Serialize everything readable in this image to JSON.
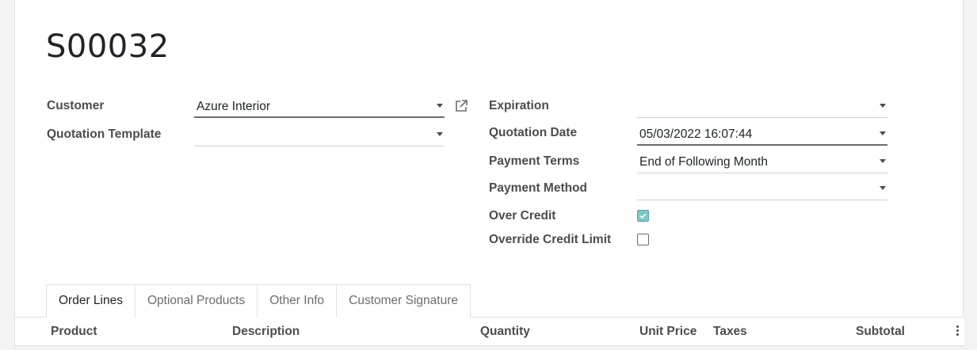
{
  "record": {
    "title": "S00032"
  },
  "left_fields": {
    "customer": {
      "label": "Customer",
      "value": "Azure Interior"
    },
    "quotation_template": {
      "label": "Quotation Template",
      "value": ""
    }
  },
  "right_fields": {
    "expiration": {
      "label": "Expiration",
      "value": ""
    },
    "quotation_date": {
      "label": "Quotation Date",
      "value": "05/03/2022 16:07:44"
    },
    "payment_terms": {
      "label": "Payment Terms",
      "value": "End of Following Month"
    },
    "payment_method": {
      "label": "Payment Method",
      "value": ""
    },
    "over_credit": {
      "label": "Over Credit",
      "checked": true
    },
    "override_credit_limit": {
      "label": "Override Credit Limit",
      "checked": false
    }
  },
  "tabs": [
    {
      "label": "Order Lines",
      "active": true
    },
    {
      "label": "Optional Products",
      "active": false
    },
    {
      "label": "Other Info",
      "active": false
    },
    {
      "label": "Customer Signature",
      "active": false
    }
  ],
  "table": {
    "columns": [
      "Product",
      "Description",
      "Quantity",
      "Unit Price",
      "Taxes",
      "Subtotal"
    ]
  },
  "icons": {
    "external_link": "external-link-icon",
    "dropdown": "caret-down-icon",
    "column_options": "kebab-icon"
  },
  "colors": {
    "checkbox_checked": "#7ec8c6"
  }
}
